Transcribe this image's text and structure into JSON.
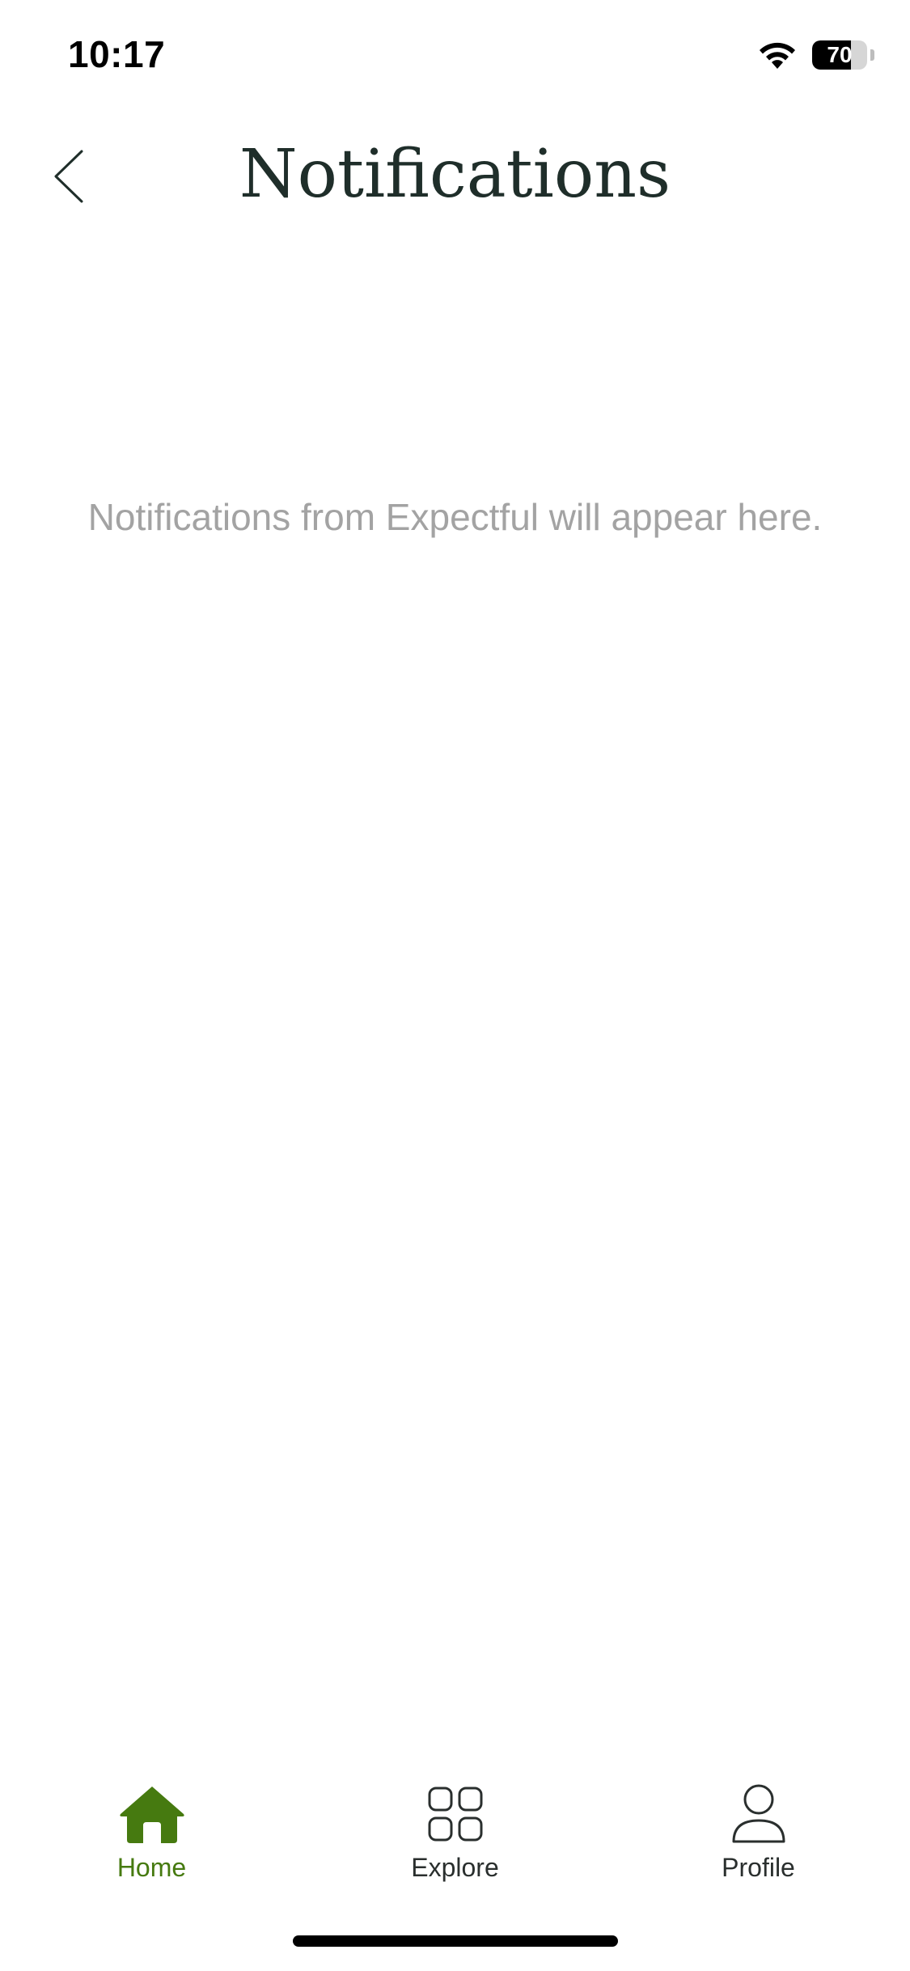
{
  "status_bar": {
    "time": "10:17",
    "battery_percent": "70",
    "battery_level": 0.7
  },
  "header": {
    "title": "Notifications",
    "back_icon": "chevron-left-icon"
  },
  "empty_state": {
    "message": "Notifications from Expectful will appear here."
  },
  "tab_bar": {
    "tabs": [
      {
        "label": "Home",
        "icon": "home-icon",
        "active": true
      },
      {
        "label": "Explore",
        "icon": "grid-icon",
        "active": false
      },
      {
        "label": "Profile",
        "icon": "person-icon",
        "active": false
      }
    ]
  },
  "colors": {
    "accent": "#467a10",
    "title": "#1f2e2a",
    "muted_text": "#a3a3a3",
    "background": "#ffffff"
  }
}
